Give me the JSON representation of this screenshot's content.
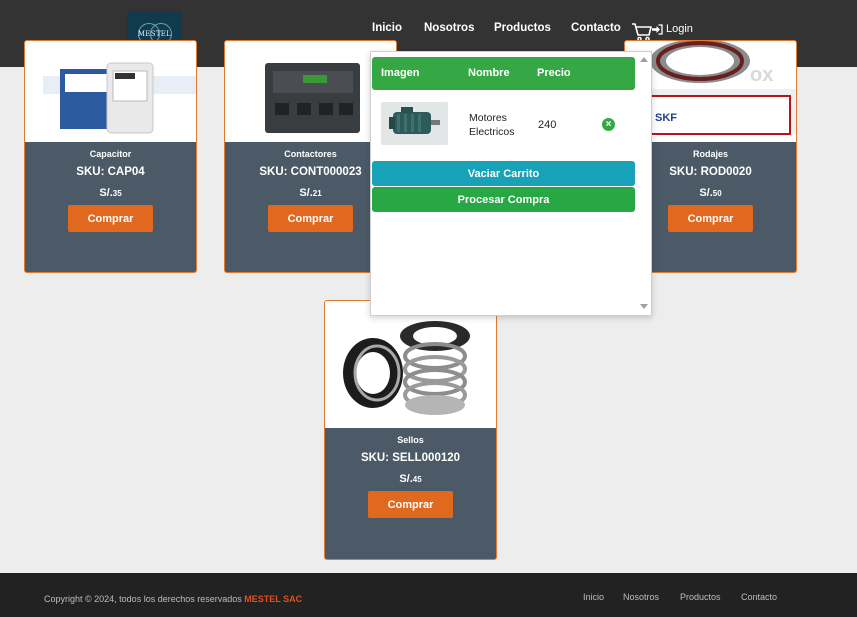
{
  "header": {
    "logo_text": "MESTEL",
    "nav": [
      "Inicio",
      "Nosotros",
      "Productos",
      "Contacto"
    ],
    "login_label": "Login"
  },
  "products": [
    {
      "name": "Capacitor",
      "sku": "SKU: CAP04",
      "currency": "S/.",
      "price": "35",
      "button": "Comprar"
    },
    {
      "name": "Contactores",
      "sku": "SKU: CONT000023",
      "currency": "S/.",
      "price": "21",
      "button": "Comprar"
    },
    {
      "name": "Rodajes",
      "sku": "SKU: ROD0020",
      "currency": "S/.",
      "price": "50",
      "button": "Comprar"
    },
    {
      "name": "Sellos",
      "sku": "SKU: SELL000120",
      "currency": "S/.",
      "price": "45",
      "button": "Comprar"
    }
  ],
  "cart": {
    "columns": [
      "Imagen",
      "Nombre",
      "Precio"
    ],
    "items": [
      {
        "name": "Motores Electricos",
        "price": "240"
      }
    ],
    "empty_button": "Vaciar Carrito",
    "process_button": "Procesar Compra"
  },
  "footer": {
    "copyright": "Copyright © 2024, todos los derechos reservados",
    "brand": "MESTEL SAC",
    "links": [
      "Inicio",
      "Nosotros",
      "Productos",
      "Contacto"
    ]
  },
  "colors": {
    "header_bg": "#333333",
    "card_bg": "#4c5a68",
    "accent_orange": "#e0691f",
    "cart_green": "#35a845",
    "info_teal": "#17a2b8",
    "footer_brand": "#e0501f"
  }
}
